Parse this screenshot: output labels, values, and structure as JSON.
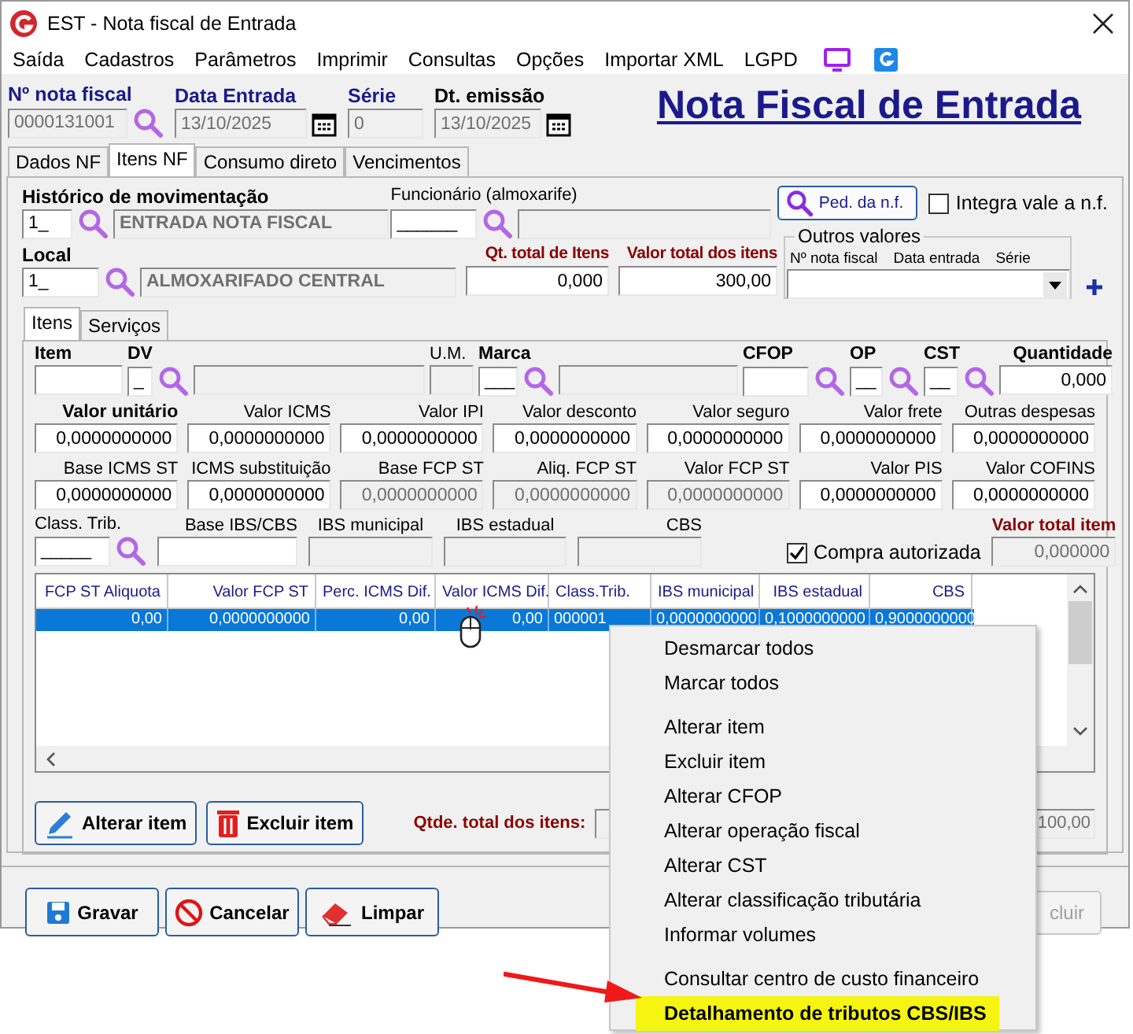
{
  "window": {
    "title": "EST - Nota fiscal de Entrada"
  },
  "menu_bar": [
    "Saída",
    "Cadastros",
    "Parâmetros",
    "Imprimir",
    "Consultas",
    "Opções",
    "Importar XML",
    "LGPD"
  ],
  "header_fields": [
    {
      "label": "Nº nota fiscal",
      "value": "0000131001",
      "kind": "lookup",
      "required": true
    },
    {
      "label": "Data Entrada",
      "value": "13/10/2025",
      "kind": "date",
      "required": true
    },
    {
      "label": "Série",
      "value": "0",
      "kind": "text",
      "required": true
    },
    {
      "label": "Dt. emissão",
      "value": "13/10/2025",
      "kind": "date",
      "required": false
    }
  ],
  "page_title": "Nota Fiscal de Entrada",
  "tabs": [
    {
      "label": "Dados NF",
      "selected": false
    },
    {
      "label": "Itens NF",
      "selected": true
    },
    {
      "label": "Consumo direto",
      "selected": false
    },
    {
      "label": "Vencimentos",
      "selected": false
    }
  ],
  "movement": {
    "label": "Histórico de movimentação",
    "code": "1_",
    "description": "ENTRADA NOTA FISCAL"
  },
  "employee": {
    "label": "Funcionário (almoxarife)",
    "code": "______"
  },
  "order_button": {
    "label": "Ped. da n.f."
  },
  "integrate": {
    "label": "Integra vale a n.f.",
    "checked": false
  },
  "location": {
    "label": "Local",
    "code": "1_",
    "description": "ALMOXARIFADO CENTRAL"
  },
  "totals": [
    {
      "label": "Qt. total de Itens",
      "value": "0,000"
    },
    {
      "label": "Valor total dos itens",
      "value": "300,00"
    }
  ],
  "other_values": {
    "title": "Outros valores",
    "columns": [
      "Nº nota fiscal",
      "Data entrada",
      "Série"
    ]
  },
  "inner_tabs": [
    {
      "label": "Itens",
      "selected": true
    },
    {
      "label": "Serviços",
      "selected": false
    }
  ],
  "item_fields": [
    {
      "label": "Item",
      "bold": true,
      "lookup": false,
      "disabled": false
    },
    {
      "label": "DV",
      "value": "_",
      "bold": true,
      "lookup": true,
      "disabled": false
    },
    {
      "lookup": false,
      "disabled": true
    },
    {
      "label": "U.M.",
      "bold": false,
      "lookup": false,
      "disabled": true
    },
    {
      "label": "Marca",
      "value": "___",
      "bold": true,
      "lookup": true,
      "disabled": false
    },
    {
      "lookup": false,
      "disabled": true
    },
    {
      "label": "CFOP",
      "bold": true,
      "lookup": true,
      "disabled": false
    },
    {
      "label": "OP",
      "value": "__",
      "bold": true,
      "lookup": true,
      "disabled": false
    },
    {
      "label": "CST",
      "value": "__",
      "bold": true,
      "lookup": true,
      "disabled": false
    },
    {
      "label": "Quantidade",
      "value": "0,000",
      "bold": true,
      "lookup": false,
      "disabled": false
    }
  ],
  "value_rows": [
    [
      {
        "label": "Valor unitário",
        "value": "0,0000000000",
        "bold": true,
        "disabled": false
      },
      {
        "label": "Valor ICMS",
        "value": "0,0000000000",
        "bold": false,
        "disabled": false
      },
      {
        "label": "Valor IPI",
        "value": "0,0000000000",
        "bold": false,
        "disabled": false
      },
      {
        "label": "Valor desconto",
        "value": "0,0000000000",
        "bold": false,
        "disabled": false
      },
      {
        "label": "Valor seguro",
        "value": "0,0000000000",
        "bold": false,
        "disabled": false
      },
      {
        "label": "Valor frete",
        "value": "0,0000000000",
        "bold": false,
        "disabled": false
      },
      {
        "label": "Outras despesas",
        "value": "0,0000000000",
        "bold": false,
        "disabled": false
      }
    ],
    [
      {
        "label": "Base ICMS ST",
        "value": "0,0000000000",
        "bold": false,
        "disabled": false
      },
      {
        "label": "ICMS substituição",
        "value": "0,0000000000",
        "bold": false,
        "disabled": false
      },
      {
        "label": "Base FCP ST",
        "value": "0,0000000000",
        "bold": false,
        "disabled": true
      },
      {
        "label": "Aliq. FCP ST",
        "value": "0,0000000000",
        "bold": false,
        "disabled": true
      },
      {
        "label": "Valor FCP ST",
        "value": "0,0000000000",
        "bold": false,
        "disabled": true
      },
      {
        "label": "Valor PIS",
        "value": "0,0000000000",
        "bold": false,
        "disabled": false
      },
      {
        "label": "Valor COFINS",
        "value": "0,0000000000",
        "bold": false,
        "disabled": false
      }
    ]
  ],
  "tax_fields": [
    {
      "label": "Class. Trib.",
      "value": "_____",
      "lookup": true,
      "disabled": false
    },
    {
      "label": "Base IBS/CBS",
      "lookup": false,
      "disabled": false
    },
    {
      "label": "IBS municipal",
      "lookup": false,
      "disabled": true
    },
    {
      "label": "IBS estadual",
      "lookup": false,
      "disabled": true
    },
    {
      "label": "CBS",
      "lookup": false,
      "disabled": true
    }
  ],
  "authorized": {
    "label": "Compra autorizada",
    "checked": true
  },
  "item_total": {
    "label": "Valor total item",
    "value": "0,000000",
    "disabled": true
  },
  "grid": {
    "columns": [
      "FCP ST Aliquota",
      "Valor FCP ST",
      "Perc. ICMS Dif.",
      "Valor ICMS Dif.",
      "Class.Trib.",
      "IBS municipal",
      "IBS estadual",
      "CBS"
    ],
    "rows": [
      {
        "cells": [
          "0,00",
          "0,0000000000",
          "0,00",
          "0,00",
          "000001",
          "0,0000000000",
          "0,1000000000",
          "0,9000000000"
        ],
        "selected": true
      }
    ]
  },
  "item_buttons": [
    "Alterar item",
    "Excluir item"
  ],
  "items_total": {
    "label": "Qtde. total dos itens:",
    "value": "100,00"
  },
  "actions": [
    "Gravar",
    "Cancelar",
    "Limpar"
  ],
  "hidden_action": {
    "label": "cluir",
    "disabled": true
  },
  "context_menu": [
    [
      {
        "label": "Desmarcar todos",
        "highlighted": false
      },
      {
        "label": "Marcar todos",
        "highlighted": false
      }
    ],
    [
      {
        "label": "Alterar item",
        "highlighted": false
      },
      {
        "label": "Excluir item",
        "highlighted": false
      },
      {
        "label": "Alterar CFOP",
        "highlighted": false
      },
      {
        "label": "Alterar operação fiscal",
        "highlighted": false
      },
      {
        "label": "Alterar CST",
        "highlighted": false
      },
      {
        "label": "Alterar classificação tributária",
        "highlighted": false
      },
      {
        "label": "Informar volumes",
        "highlighted": false
      }
    ],
    [
      {
        "label": "Consultar centro de custo financeiro",
        "highlighted": false
      },
      {
        "label": "Detalhamento de tributos CBS/IBS",
        "highlighted": true
      }
    ]
  ]
}
